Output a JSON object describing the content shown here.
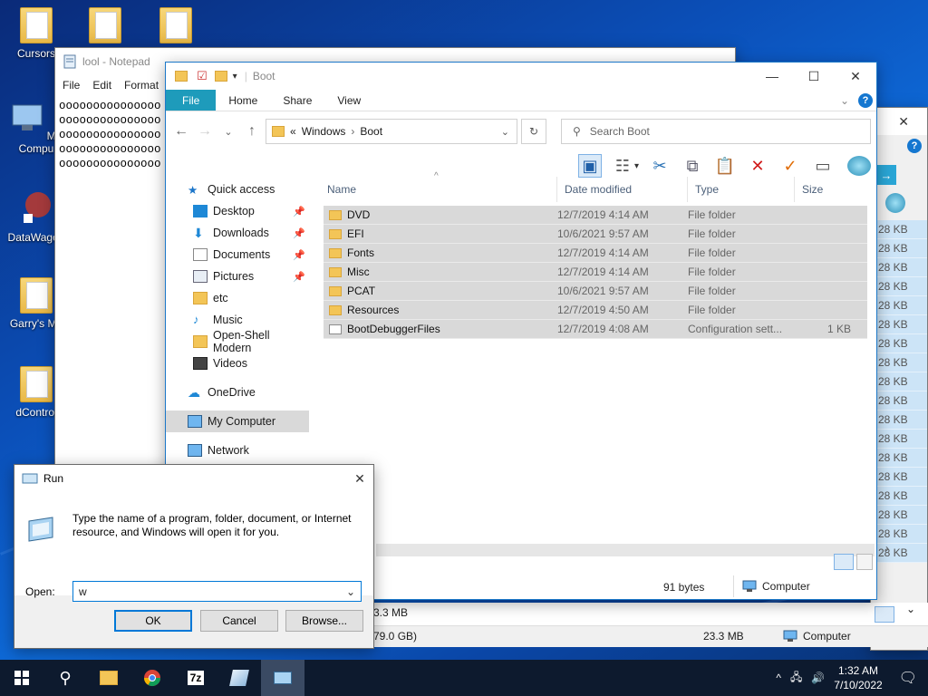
{
  "desktop": {
    "icons": [
      {
        "label": "Cursors"
      },
      {
        "label": "My Compu"
      },
      {
        "label": "DataWagon"
      },
      {
        "label": "Garry's Mo"
      },
      {
        "label": "dControl"
      }
    ]
  },
  "notepad": {
    "title": "lool - Notepad",
    "menu": [
      "File",
      "Edit",
      "Format"
    ],
    "text": "ooooooooooooooo\nooooooooooooooo\nooooooooooooooo\nooooooooooooooo\nooooooooooooooo"
  },
  "explorer": {
    "title": "Boot",
    "tabs": [
      "File",
      "Home",
      "Share",
      "View"
    ],
    "help": "?",
    "address": {
      "chevrons": "«",
      "crumbs": [
        "Windows",
        "Boot"
      ]
    },
    "search_placeholder": "Search Boot",
    "columns": {
      "name": "Name",
      "date": "Date modified",
      "type": "Type",
      "size": "Size"
    },
    "nav": {
      "quick_access": "Quick access",
      "items": [
        "Desktop",
        "Downloads",
        "Documents",
        "Pictures",
        "etc",
        "Music",
        "Open-Shell Modern",
        "Videos"
      ],
      "onedrive": "OneDrive",
      "my_computer": "My Computer",
      "network": "Network"
    },
    "files": [
      {
        "name": "DVD",
        "date": "12/7/2019 4:14 AM",
        "type": "File folder",
        "size": ""
      },
      {
        "name": "EFI",
        "date": "10/6/2021 9:57 AM",
        "type": "File folder",
        "size": ""
      },
      {
        "name": "Fonts",
        "date": "12/7/2019 4:14 AM",
        "type": "File folder",
        "size": ""
      },
      {
        "name": "Misc",
        "date": "12/7/2019 4:14 AM",
        "type": "File folder",
        "size": ""
      },
      {
        "name": "PCAT",
        "date": "10/6/2021 9:57 AM",
        "type": "File folder",
        "size": ""
      },
      {
        "name": "Resources",
        "date": "12/7/2019 4:50 AM",
        "type": "File folder",
        "size": ""
      },
      {
        "name": "BootDebuggerFiles",
        "date": "12/7/2019 4:08 AM",
        "type": "Configuration sett...",
        "size": "1 KB"
      }
    ],
    "status": {
      "bytes": "91 bytes",
      "location": "Computer"
    }
  },
  "back_explorer": {
    "sizes": [
      "28 KB",
      "28 KB",
      "28 KB",
      "28 KB",
      "28 KB",
      "28 KB",
      "28 KB",
      "28 KB",
      "28 KB",
      "28 KB",
      "28 KB",
      "28 KB",
      "28 KB",
      "28 KB",
      "28 KB",
      "28 KB",
      "28 KB",
      "28 KB"
    ],
    "row_size": "3.3 MB",
    "status_left": "79.0 GB)",
    "status_mid": "23.3 MB",
    "status_right": "Computer"
  },
  "run": {
    "title": "Run",
    "description": "Type the name of a program, folder, document, or Internet resource, and Windows will open it for you.",
    "open_label": "Open:",
    "value": "w",
    "ok": "OK",
    "cancel": "Cancel",
    "browse": "Browse..."
  },
  "taskbar": {
    "time": "1:32 AM",
    "date": "7/10/2022",
    "apps": [
      "start",
      "search",
      "file-explorer",
      "chrome",
      "7zip",
      "app",
      "run"
    ]
  },
  "colors": {
    "accent": "#0078d7",
    "ribbon_file": "#1e9bbb",
    "taskbar": "#0d1a2e"
  }
}
